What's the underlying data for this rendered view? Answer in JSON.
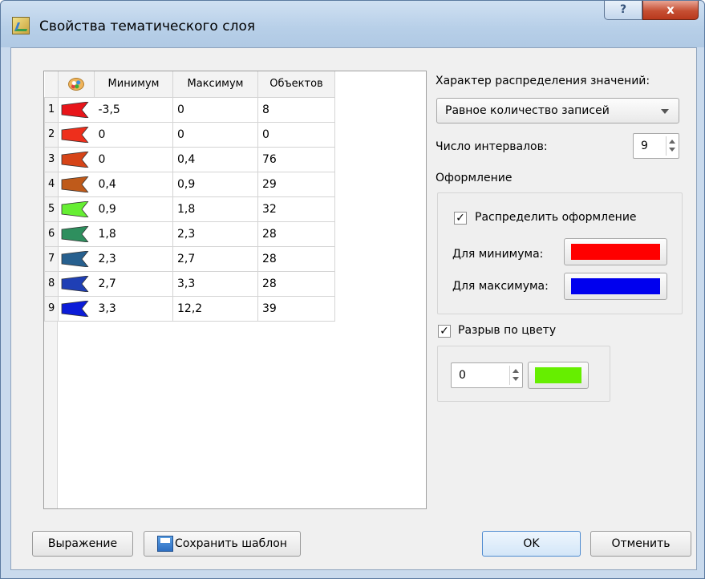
{
  "window": {
    "title": "Свойства тематического слоя",
    "help_label": "?",
    "close_label": "x"
  },
  "table": {
    "columns": [
      "Минимум",
      "Максимум",
      "Объектов"
    ],
    "rows": [
      {
        "num": "1",
        "color": "#e8151a",
        "min": "-3,5",
        "max": "0",
        "count": "8"
      },
      {
        "num": "2",
        "color": "#ee2f1c",
        "min": "0",
        "max": "0",
        "count": "0"
      },
      {
        "num": "3",
        "color": "#d64418",
        "min": "0",
        "max": "0,4",
        "count": "76"
      },
      {
        "num": "4",
        "color": "#bf5a1a",
        "min": "0,4",
        "max": "0,9",
        "count": "29"
      },
      {
        "num": "5",
        "color": "#66ee33",
        "min": "0,9",
        "max": "1,8",
        "count": "32"
      },
      {
        "num": "6",
        "color": "#2e8f5e",
        "min": "1,8",
        "max": "2,3",
        "count": "28"
      },
      {
        "num": "7",
        "color": "#27608f",
        "min": "2,3",
        "max": "2,7",
        "count": "28"
      },
      {
        "num": "8",
        "color": "#1f3fb5",
        "min": "2,7",
        "max": "3,3",
        "count": "28"
      },
      {
        "num": "9",
        "color": "#0c1cd8",
        "min": "3,3",
        "max": "12,2",
        "count": "39"
      }
    ]
  },
  "distribution": {
    "label": "Характер распределения значений:",
    "selected": "Равное количество записей"
  },
  "intervals": {
    "label": "Число интервалов:",
    "value": "9"
  },
  "design": {
    "label": "Оформление",
    "distribute_label": "Распределить оформление",
    "distribute_checked": true,
    "min_label": "Для минимума:",
    "min_color": "#ff0000",
    "max_label": "Для максимума:",
    "max_color": "#0000ee"
  },
  "color_break": {
    "label": "Разрыв по цвету",
    "checked": true,
    "value": "0",
    "color": "#66ee00"
  },
  "buttons": {
    "expression": "Выражение",
    "save_template": "Сохранить шаблон",
    "ok": "OK",
    "cancel": "Отменить"
  },
  "check_mark": "✓"
}
